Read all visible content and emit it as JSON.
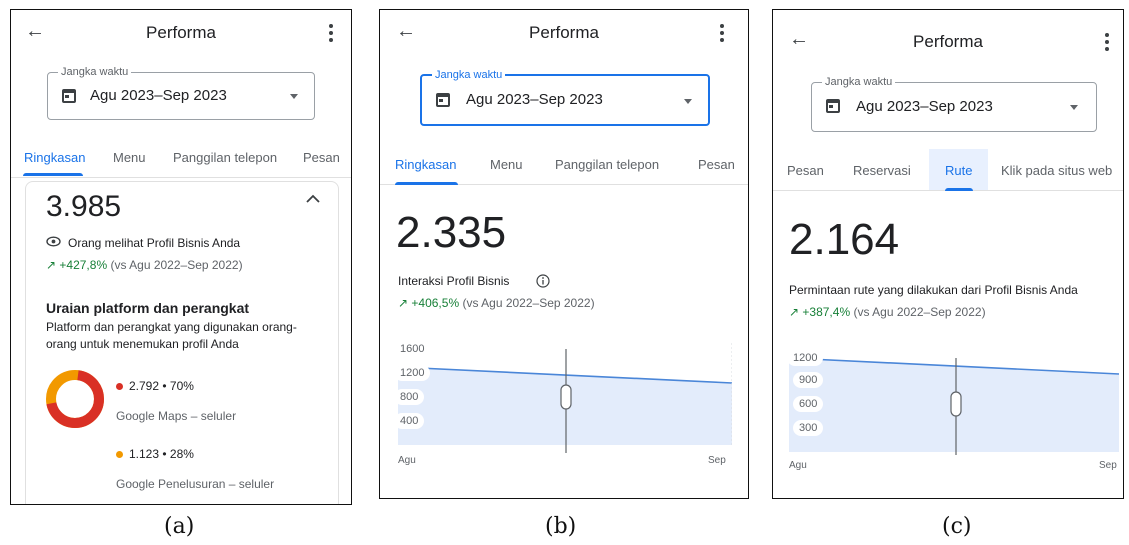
{
  "panels": {
    "a": {
      "caption": "(a)",
      "title": "Performa",
      "field_label": "Jangka waktu",
      "field_value": "Agu 2023–Sep 2023",
      "tabs": [
        "Ringkasan",
        "Menu",
        "Panggilan telepon",
        "Pesan"
      ],
      "active_tab": "Ringkasan",
      "metric_value": "3.985",
      "metric_label": "Orang melihat Profil Bisnis Anda",
      "delta": "+427,8%",
      "compare": "(vs Agu 2022–Sep 2022)",
      "section_title": "Uraian platform dan perangkat",
      "section_desc_1": "Platform dan perangkat yang digunakan orang-",
      "section_desc_2": "orang untuk menemukan profil Anda",
      "breakdown": [
        {
          "value": "2.792 • 70%",
          "label": "Google Maps – seluler",
          "color": "#d93025",
          "share": 0.7
        },
        {
          "value": "1.123 • 28%",
          "label": "Google Penelusuran – seluler",
          "color": "#f29900",
          "share": 0.28
        }
      ]
    },
    "b": {
      "caption": "(b)",
      "title": "Performa",
      "field_label": "Jangka waktu",
      "field_value": "Agu 2023–Sep 2023",
      "tabs": [
        "Ringkasan",
        "Menu",
        "Panggilan telepon",
        "Pesan"
      ],
      "active_tab": "Ringkasan",
      "metric_value": "2.335",
      "metric_label": "Interaksi Profil Bisnis",
      "delta": "+406,5%",
      "compare": "(vs Agu 2022–Sep 2022)",
      "chart": {
        "yticks": [
          "1600",
          "1200",
          "800",
          "400"
        ],
        "x_start": "Agu",
        "x_end": "Sep"
      }
    },
    "c": {
      "caption": "(c)",
      "title": "Performa",
      "field_label": "Jangka waktu",
      "field_value": "Agu 2023–Sep 2023",
      "tabs": [
        "Pesan",
        "Reservasi",
        "Rute",
        "Klik pada situs web"
      ],
      "active_tab": "Rute",
      "metric_value": "2.164",
      "metric_label": "Permintaan rute yang dilakukan dari Profil Bisnis Anda",
      "delta": "+387,4%",
      "compare": "(vs Agu 2022–Sep 2022)",
      "chart": {
        "yticks": [
          "1200",
          "900",
          "600",
          "300"
        ],
        "x_start": "Agu",
        "x_end": "Sep"
      }
    }
  },
  "colors": {
    "accent": "#1a73e8",
    "positive": "#188038",
    "maps": "#d93025",
    "search": "#f29900",
    "chart_fill": "#e3ecfb"
  },
  "icons": {
    "back": "arrow-left-icon",
    "more": "more-vert-icon",
    "calendar": "calendar-icon",
    "dropdown": "dropdown-caret-icon",
    "eye": "eye-icon",
    "trend": "trending-up-icon",
    "info": "info-icon",
    "collapse": "chevron-up-icon"
  }
}
